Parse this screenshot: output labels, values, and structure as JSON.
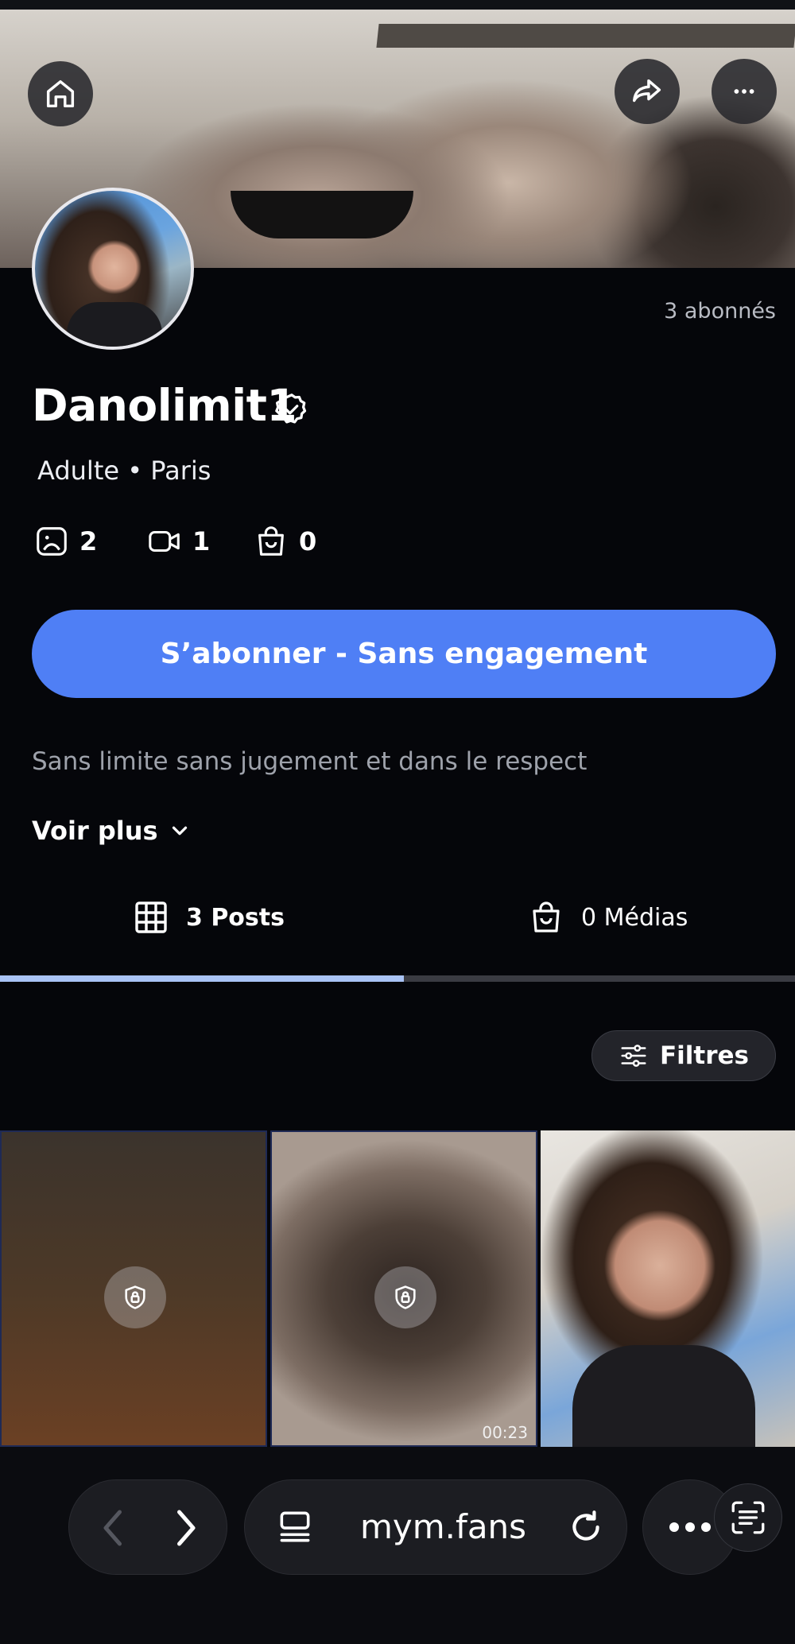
{
  "profile": {
    "name": "Danolimit1",
    "meta": "Adulte • Paris",
    "subscribers": "3 abonnés",
    "bio": "Sans limite sans jugement et dans le respect",
    "see_more": "Voir plus"
  },
  "stats": {
    "photos": "2",
    "videos": "1",
    "bag": "0"
  },
  "subscribe_label": "S’abonner - Sans engagement",
  "tabs": {
    "posts": "3 Posts",
    "media": "0 Médias"
  },
  "filters_label": "Filtres",
  "grid": {
    "video_duration": "00:23"
  },
  "browser": {
    "url": "mym.fans"
  },
  "icons": [
    "home-icon",
    "share-icon",
    "more-icon",
    "verified-icon",
    "photo-icon",
    "video-icon",
    "bag-icon",
    "chevron-down-icon",
    "grid-icon",
    "filters-icon",
    "lock-icon",
    "back-icon",
    "forward-icon",
    "tabs-icon",
    "reload-icon",
    "scan-icon"
  ],
  "colors": {
    "accent": "#4f7ff5",
    "tab_active": "#a9c3f5",
    "background": "#05060a"
  }
}
